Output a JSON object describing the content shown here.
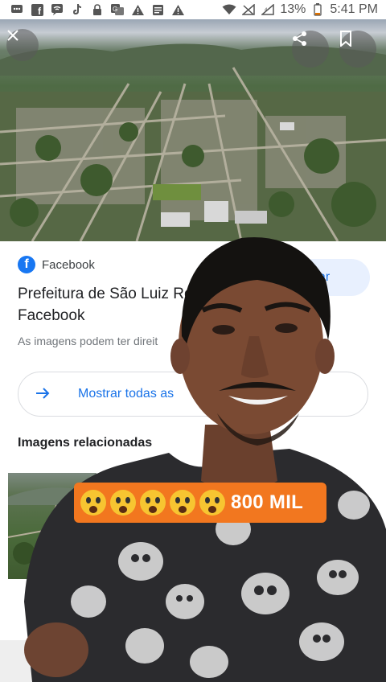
{
  "status_bar": {
    "battery": "13%",
    "time": "5:41 PM",
    "left_icons": [
      "message-icon",
      "facebook-icon",
      "wifi-bubble-icon",
      "tiktok-icon",
      "lock-icon",
      "translate-icon",
      "warning-icon",
      "news-icon",
      "warning-icon"
    ],
    "right_icons": [
      "wifi-icon",
      "no-signal-icon",
      "signal-icon",
      "battery-icon"
    ]
  },
  "hero": {
    "close_icon": "close-icon",
    "share_icon": "share-icon",
    "bookmark_icon": "bookmark-icon"
  },
  "card": {
    "source": "Facebook",
    "title": "Prefeitura de São Luiz Ro Facebook",
    "visit_label": "ar",
    "rights_text": "As imagens podem ter direit",
    "show_all_label": "Mostrar todas as",
    "related_heading": "Imagens relacionadas"
  },
  "overlay": {
    "sticker_text": "800 MIL",
    "emoji_count": 5,
    "colors": {
      "sticker_bg": "#f2771f",
      "accent": "#1a73e8"
    }
  }
}
